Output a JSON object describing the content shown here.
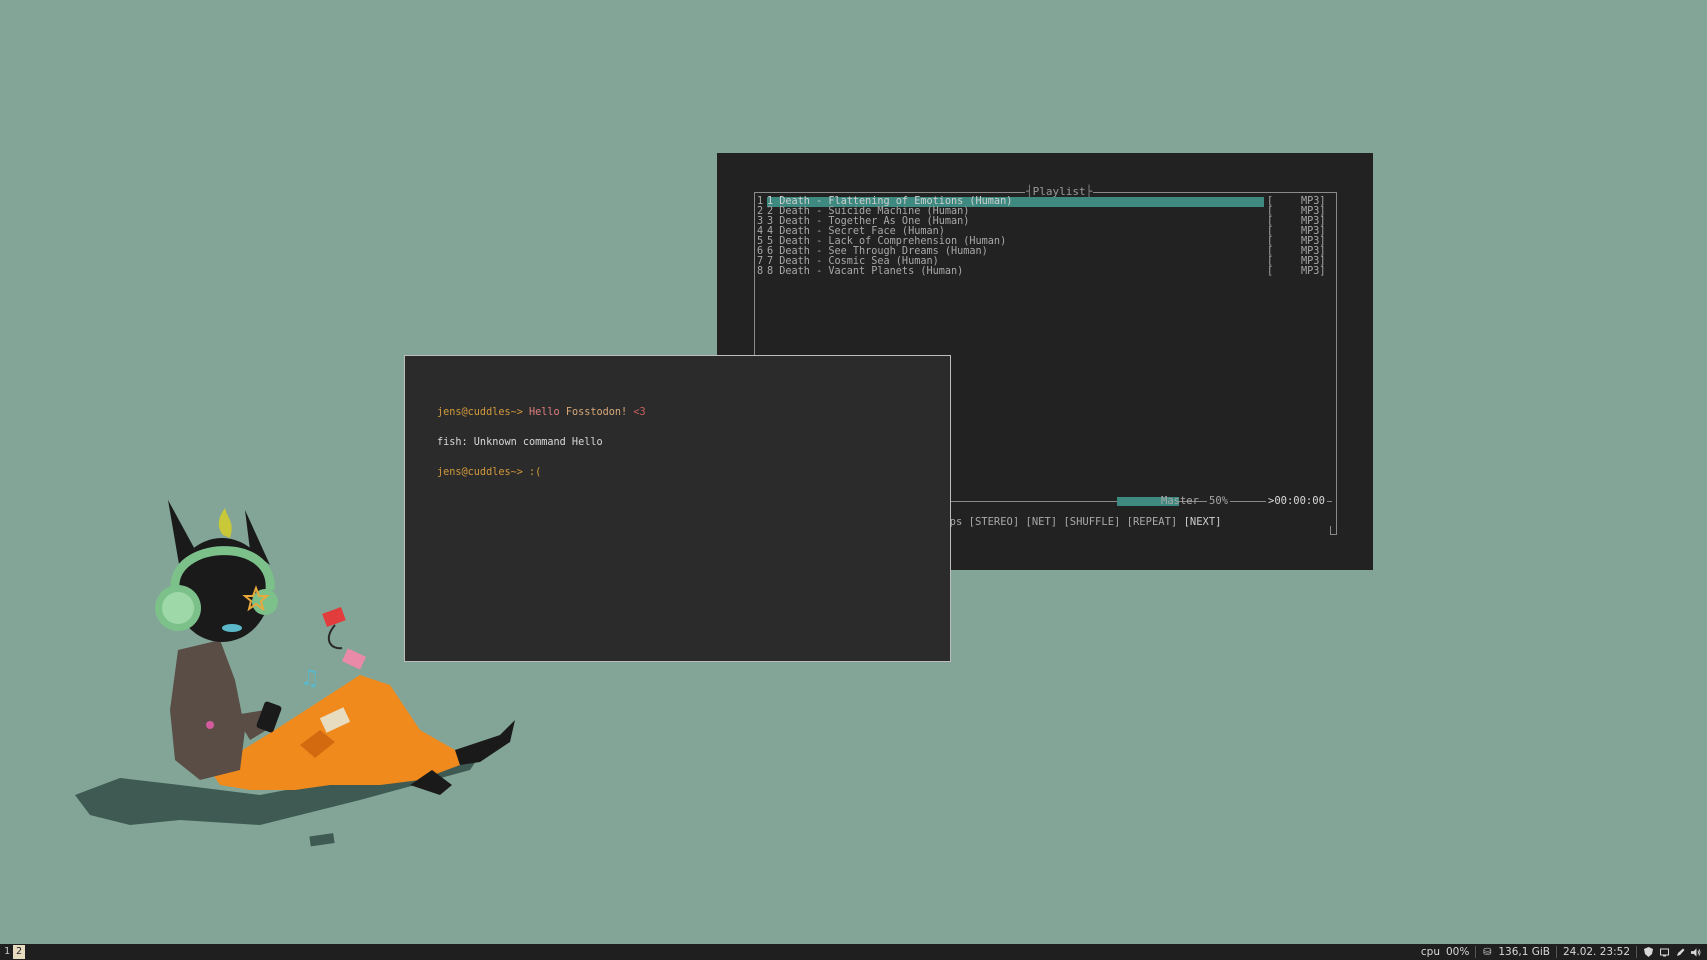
{
  "cmus": {
    "playlist_title": "Playlist",
    "tracks": [
      {
        "num": "1",
        "name": "1 Death - Flattening of Emotions (Human)",
        "bracket": "[",
        "format": "MP3]"
      },
      {
        "num": "2",
        "name": "2 Death - Suicide Machine (Human)",
        "bracket": "[",
        "format": "MP3]"
      },
      {
        "num": "3",
        "name": "3 Death - Together As One (Human)",
        "bracket": "[",
        "format": "MP3]"
      },
      {
        "num": "4",
        "name": "4 Death - Secret Face (Human)",
        "bracket": "[",
        "format": "MP3]"
      },
      {
        "num": "5",
        "name": "5 Death - Lack of Comprehension (Human)",
        "bracket": "[",
        "format": "MP3]"
      },
      {
        "num": "6",
        "name": "6 Death - See Through Dreams (Human)",
        "bracket": "[",
        "format": "MP3]"
      },
      {
        "num": "7",
        "name": "7 Death - Cosmic Sea (Human)",
        "bracket": "[",
        "format": "MP3]"
      },
      {
        "num": "8",
        "name": "8 Death - Vacant Planets (Human)",
        "bracket": "[",
        "format": "MP3]"
      }
    ],
    "volume_label": "Master",
    "volume_level": "50%",
    "volume_fraction": 0.5,
    "time": ">00:00:00",
    "flags_prefix": "kbps",
    "flags": "[STEREO] [NET] [SHUFFLE] [REPEAT]",
    "next_flag": "[NEXT]",
    "accent": "#3e8a80"
  },
  "terminal": {
    "line1_prompt": "jens@cuddles~>",
    "line1_cmd": "Hello",
    "line1_arg": "Fosstodon!",
    "line1_heart": "<3",
    "line2": "fish: Unknown command Hello",
    "line3_prompt": "jens@cuddles~>",
    "line3_text": ":("
  },
  "taskbar": {
    "workspaces": [
      "1",
      "2"
    ],
    "active_workspace": "2",
    "cpu_label": "cpu",
    "cpu_value": "00%",
    "disk": "136,1 GiB",
    "datetime": "24.02. 23:52",
    "icons": [
      "shield-icon",
      "display-icon",
      "pencil-icon",
      "speaker-icon"
    ]
  },
  "colors": {
    "desktop": "#82a597",
    "window_bg": "#222222",
    "taskbar_bg": "#1f1f1f"
  }
}
